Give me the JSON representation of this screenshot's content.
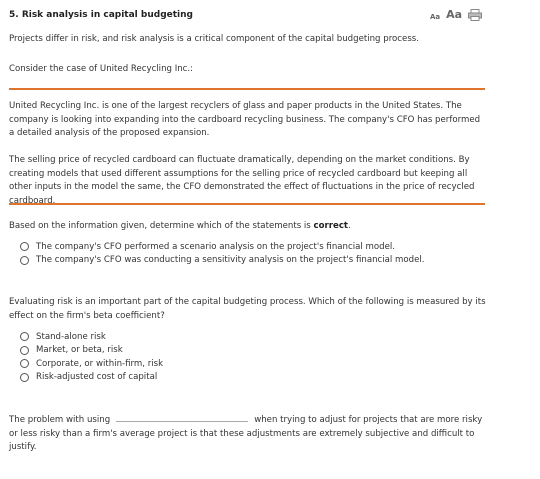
{
  "question": {
    "number_title": "5.  Risk analysis in capital budgeting",
    "intro": "Projects differ in risk, and risk analysis is a critical component of the capital budgeting process.",
    "consider": "Consider the case of United Recycling Inc.:"
  },
  "toolbar": {
    "font_small_label": "Aa",
    "font_large_label": "Aa",
    "print_icon": "print-icon"
  },
  "case": {
    "para1": "United Recycling Inc. is one of the largest recyclers of glass and paper products in the United States. The company is looking into expanding into the cardboard recycling business. The company's CFO has performed a detailed analysis of the proposed expansion.",
    "para2": "The selling price of recycled cardboard can fluctuate dramatically, depending on the market conditions. By creating models that used different assumptions for the selling price of recycled cardboard but keeping all other inputs in the model the same, the CFO demonstrated the effect of fluctuations in the price of recycled cardboard."
  },
  "q1": {
    "prompt_start": "Based on the information given, determine which of the statements is ",
    "prompt_bold": "correct",
    "prompt_end": ".",
    "options": [
      "The company's CFO performed a scenario analysis on the project's financial model.",
      "The company's CFO was conducting a sensitivity analysis on the project's financial model."
    ]
  },
  "q2": {
    "prompt": "Evaluating risk is an important part of the capital budgeting process. Which of the following is measured by its effect on the firm's beta coefficient?",
    "options": [
      "Stand-alone risk",
      "Market, or beta, risk",
      "Corporate, or within-firm, risk",
      "Risk-adjusted cost of capital"
    ]
  },
  "q3": {
    "text_before": "The problem with using",
    "text_after": "when trying to adjust for projects that are more risky or less risky than a firm's average project is that these adjustments are extremely subjective and difficult to justify."
  },
  "colors": {
    "accent_rule": "#e0742c"
  }
}
